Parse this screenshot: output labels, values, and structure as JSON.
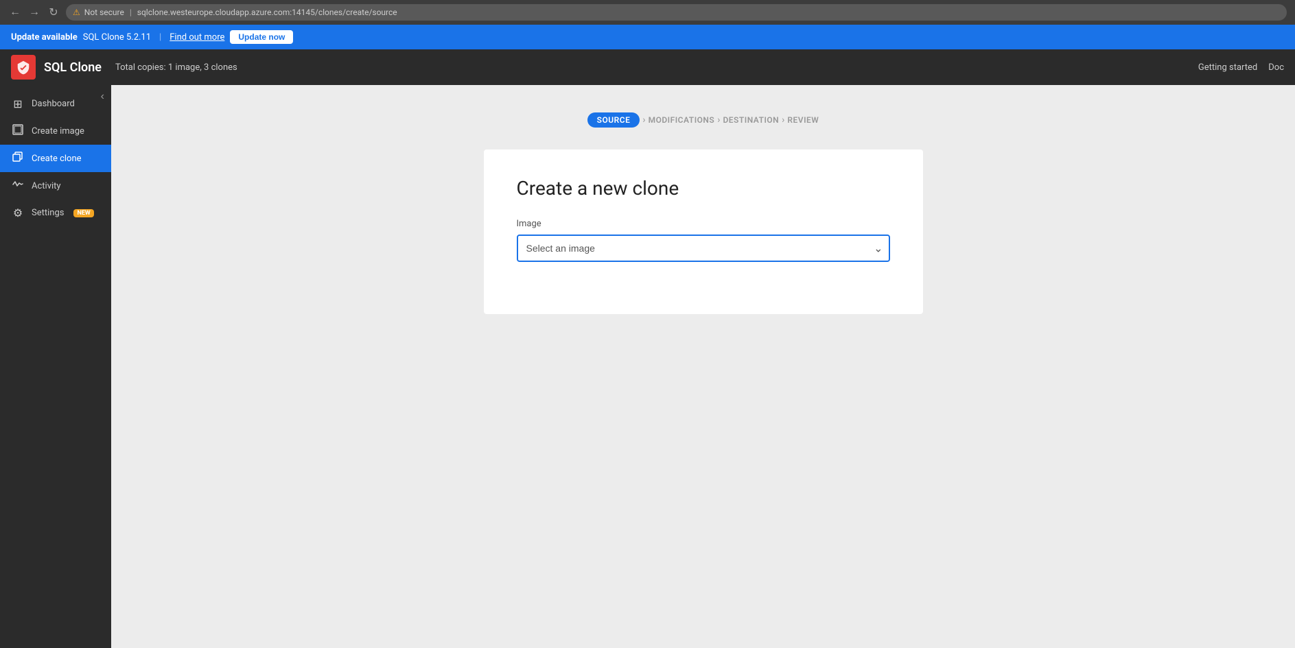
{
  "browser": {
    "back_icon": "←",
    "forward_icon": "→",
    "reload_icon": "↻",
    "security_label": "Not secure",
    "url": "sqlclone.westeurope.cloudapp.azure.com:14145/clones/create/source"
  },
  "update_banner": {
    "title": "Update available",
    "version": "SQL Clone 5.2.11",
    "separator": "|",
    "find_out_more": "Find out more",
    "update_now": "Update now"
  },
  "app_header": {
    "logo_text": "🛡",
    "app_name": "SQL Clone",
    "subtitle": "Total copies: 1 image, 3 clones",
    "links": [
      {
        "label": "Getting started"
      },
      {
        "label": "Doc"
      }
    ]
  },
  "sidebar": {
    "collapse_icon": "‹",
    "items": [
      {
        "id": "dashboard",
        "icon": "⊞",
        "label": "Dashboard",
        "active": false
      },
      {
        "id": "create-image",
        "icon": "◻",
        "label": "Create image",
        "active": false
      },
      {
        "id": "create-clone",
        "icon": "◱",
        "label": "Create clone",
        "active": true
      },
      {
        "id": "activity",
        "icon": "〜",
        "label": "Activity",
        "active": false
      },
      {
        "id": "settings",
        "icon": "⚙",
        "label": "Settings",
        "active": false,
        "badge": "NEW"
      }
    ]
  },
  "wizard": {
    "steps": [
      {
        "label": "SOURCE",
        "active": true
      },
      {
        "label": "MODIFICATIONS",
        "active": false
      },
      {
        "label": "DESTINATION",
        "active": false
      },
      {
        "label": "REVIEW",
        "active": false
      }
    ],
    "chevron": "›"
  },
  "form": {
    "page_title": "Create a new clone",
    "image_label": "Image",
    "image_placeholder": "Select an image",
    "image_options": []
  }
}
